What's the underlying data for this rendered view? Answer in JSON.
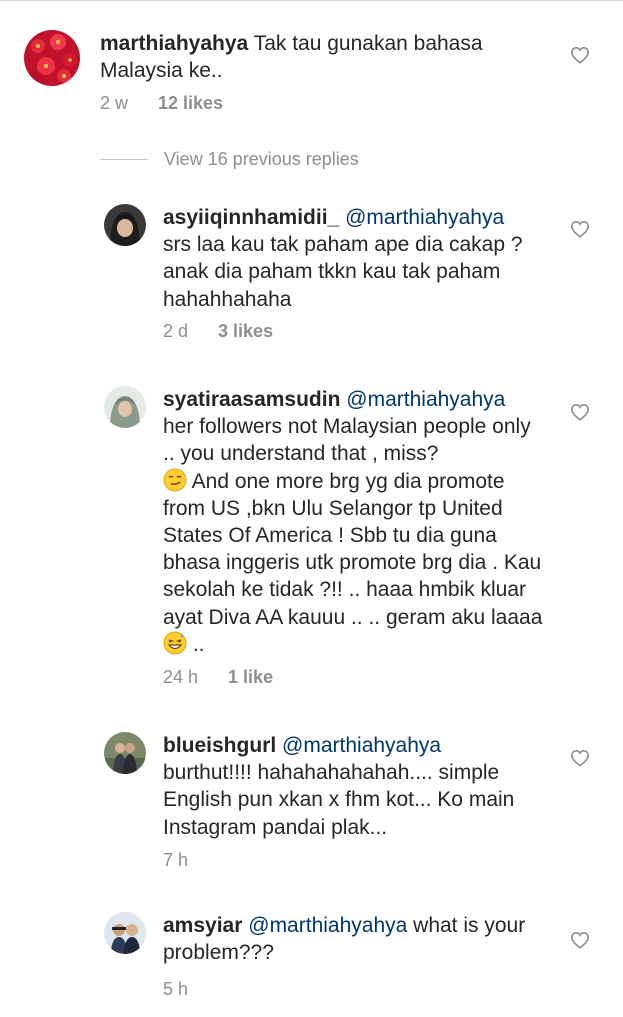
{
  "comments": [
    {
      "username": "marthiahyahya",
      "mention": "",
      "text": " Tak tau gunakan bahasa Malaysia ke..",
      "time": "2 w",
      "likes": "12 likes"
    },
    {
      "username": "asyiiqinnhamidii_",
      "mention": "@marthiahyahya",
      "text": "srs laa kau tak paham ape dia cakap ? anak dia paham tkkn kau tak paham hahahhahaha",
      "time": "2 d",
      "likes": "3 likes"
    },
    {
      "username": "syatiraasamsudin",
      "mention": "@marthiahyahya",
      "text_a": "her followers not Malaysian people only .. you understand that , miss?",
      "text_b": "  And one more brg yg dia promote from US ,bkn Ulu Selangor tp United States Of America ! Sbb tu dia guna bhasa inggeris utk promote brg dia . Kau sekolah ke tidak ?!! .. haaa hmbik kluar ayat Diva AA kauuu .. .. geram aku laaaa",
      "text_c": " ..",
      "time": "24 h",
      "likes": "1 like"
    },
    {
      "username": "blueishgurl",
      "mention": "@marthiahyahya",
      "text": "burthut!!!! hahahahahahah.... simple English pun xkan x fhm kot... Ko main Instagram pandai plak...",
      "time": "7 h"
    },
    {
      "username": "amsyiar",
      "mention": "@marthiahyahya",
      "text": " what is your problem???",
      "time": "5 h"
    }
  ],
  "view_replies": "View 16 previous replies",
  "icons": {
    "like": "heart-outline-icon",
    "smirk": "smirking-face-emoji",
    "sweat": "grinning-face-with-sweat-emoji"
  },
  "colors": {
    "text": "#262626",
    "mention": "#00376b",
    "meta": "#8e8e8e"
  }
}
